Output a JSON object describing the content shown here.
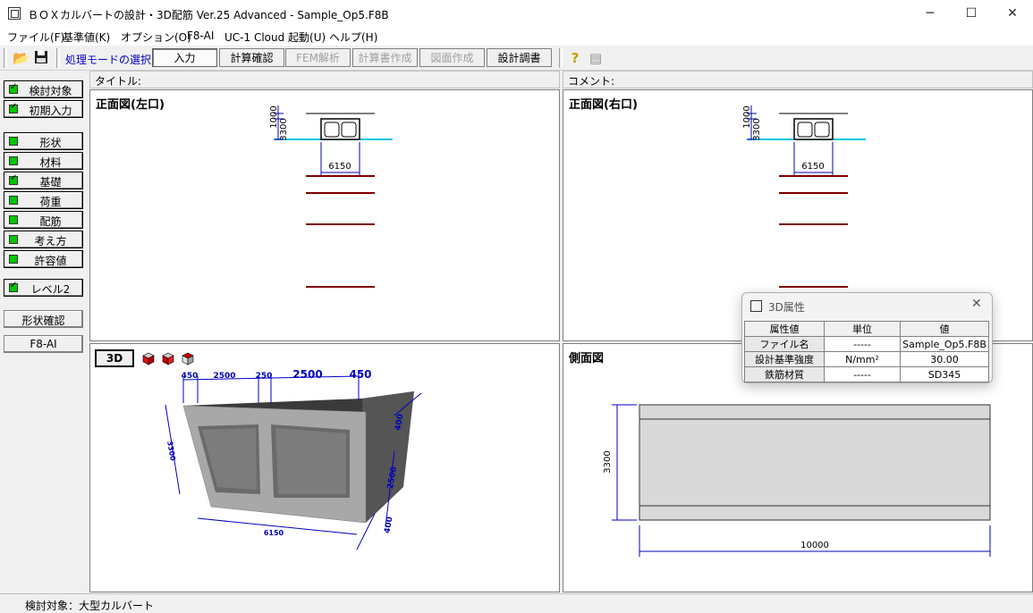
{
  "window": {
    "title": "ＢＯＸカルバートの設計・3D配筋 Ver.25 Advanced - Sample_Op5.F8B"
  },
  "menu": [
    "ファイル(F)",
    "基準値(K)",
    "オプション(O)",
    "F8-AI",
    "UC-1 Cloud 起動(U)",
    "ヘルプ(H)"
  ],
  "toolbar": {
    "mode_label": "処理モードの選択",
    "buttons": [
      "入力",
      "計算確認",
      "FEM解析",
      "計算書作成",
      "図面作成",
      "設計調書"
    ]
  },
  "sidebar": {
    "group1": [
      "検討対象",
      "初期入力"
    ],
    "group2": [
      "形状",
      "材料",
      "基礎",
      "荷重",
      "配筋",
      "考え方",
      "許容値"
    ],
    "group3": [
      "レベル2"
    ],
    "shape_check": "形状確認",
    "f8ai": "F8-AI"
  },
  "headers": {
    "title": "タイトル:",
    "comment": "コメント:"
  },
  "panes": {
    "front_left": {
      "title": "正面図(左口)",
      "dims": {
        "top": "1000",
        "height": "3300",
        "width": "6150"
      }
    },
    "front_right": {
      "title": "正面図(右口)",
      "dims": {
        "top": "1000",
        "height": "3300",
        "width": "6150"
      }
    },
    "view3d": {
      "button": "3D",
      "dims": {
        "d1": "450",
        "d2": "2500",
        "d3": "250",
        "d4": "2500",
        "d5": "450",
        "h1": "400",
        "h2": "2500",
        "h3": "400",
        "height": "3300",
        "width": "6150"
      }
    },
    "side": {
      "title": "側面図",
      "dims": {
        "height": "3300",
        "length": "10000"
      }
    }
  },
  "dialog": {
    "title": "3D属性",
    "headers": [
      "属性値",
      "単位",
      "値"
    ],
    "rows": [
      [
        "ファイル名",
        "-----",
        "Sample_Op5.F8B"
      ],
      [
        "設計基準強度",
        "N/mm²",
        "30.00"
      ],
      [
        "鉄筋材質",
        "-----",
        "SD345"
      ]
    ]
  },
  "status": "検討対象：大型カルバート",
  "colors": {
    "water": "#00c8e0",
    "ground": "#800000",
    "dim": "#0000c0"
  }
}
